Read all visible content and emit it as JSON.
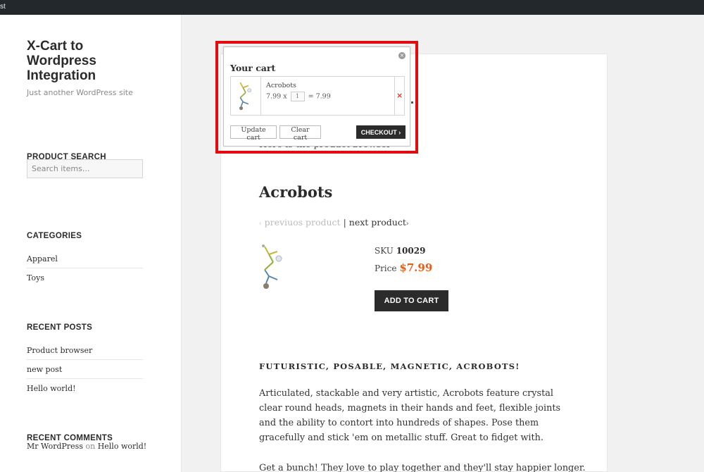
{
  "adminbar": {
    "fragment": "st"
  },
  "site": {
    "title": "X-Cart to Wordpress Integration",
    "description": "Just another WordPress site"
  },
  "sidebar": {
    "product_search": {
      "title": "PRODUCT SEARCH",
      "placeholder": "Search items..."
    },
    "categories": {
      "title": "CATEGORIES",
      "items": [
        "Apparel",
        "Toys"
      ]
    },
    "recent_posts": {
      "title": "RECENT POSTS",
      "items": [
        "Product browser",
        "new post",
        "Hello world!"
      ]
    },
    "recent_comments": {
      "title": "RECENT COMMENTS",
      "author": "Mr WordPress",
      "on": "on",
      "post": "Hello world!"
    }
  },
  "main": {
    "intro": "Here is the product browser",
    "product": {
      "title": "Acrobots",
      "prev_label": "previuos product",
      "nav_sep": "|",
      "next_label": "next product",
      "sku_label": "SKU",
      "sku_value": "10029",
      "price_label": "Price",
      "price_value": "$7.99",
      "add_to_cart": "ADD TO CART",
      "heading": "FUTURISTIC, POSABLE, MAGNETIC, ACROBOTS!",
      "description_1": "Articulated, stackable and very artistic, Acrobots feature crystal clear round heads, magnets in their hands and feet, flexible joints and the ability to contort into hundreds of shapes. Pose them gracefully and stick 'em on metallic stuff. Great to fidget with.",
      "description_2": "Get a bunch! They love to play together and they'll stay happier longer."
    }
  },
  "cart": {
    "title": "Your cart",
    "close_glyph": "×",
    "item": {
      "name": "Acrobots",
      "unit_price": "7.99",
      "times": "x",
      "qty": "1",
      "equals_total": "= 7.99",
      "remove_glyph": "×"
    },
    "update_label": "Update cart",
    "clear_label": "Clear cart",
    "checkout_label": "CHECKOUT",
    "checkout_arrow": "›"
  },
  "colors": {
    "price": "#e2601f",
    "highlight": "#e30b10",
    "button_dark": "#2b2b2b"
  }
}
